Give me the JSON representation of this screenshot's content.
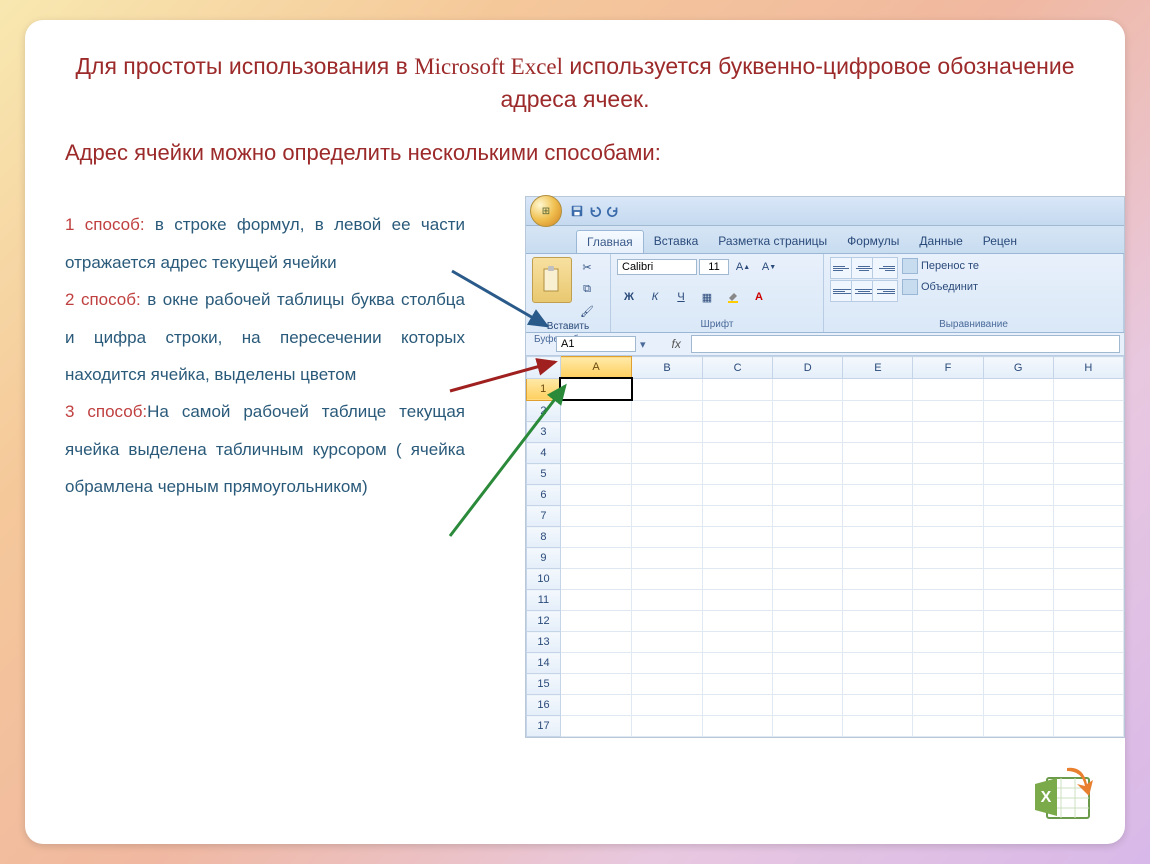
{
  "title_part1": "Для простоты использования в ",
  "title_app": "Microsoft Excel",
  "title_part2": "  используется  буквенно-цифровое обозначение адреса  ячеек.",
  "subtitle": "Адрес ячейки можно определить несколькими способами:",
  "methods": {
    "m1_label": "1 способ:",
    "m1_text": " в строке формул, в левой ее части отражается адрес текущей ячейки",
    "m2_label": "2 способ:",
    "m2_text": "  в окне рабочей таблицы буква столбца и цифра строки, на пересечении которых находится ячейка,  выделены цветом",
    "m3_label": "3 способ:",
    "m3_text": "На самой рабочей таблице текущая ячейка выделена табличным курсором ( ячейка обрамлена черным прямоугольником)"
  },
  "excel": {
    "tabs": [
      "Главная",
      "Вставка",
      "Разметка страницы",
      "Формулы",
      "Данные",
      "Рецен"
    ],
    "active_tab": 0,
    "paste_label": "Вставить",
    "group_clipboard": "Буфер обмена",
    "group_font": "Шрифт",
    "group_align": "Выравнивание",
    "font_name": "Calibri",
    "font_size": "11",
    "wrap_text": "Перенос те",
    "merge_text": "Объединит",
    "bold": "Ж",
    "italic": "К",
    "underline": "Ч",
    "namebox": "A1",
    "fx_label": "fx",
    "columns": [
      "A",
      "B",
      "C",
      "D",
      "E",
      "F",
      "G",
      "H"
    ],
    "rows": [
      "1",
      "2",
      "3",
      "4",
      "5",
      "6",
      "7",
      "8",
      "9",
      "10",
      "11",
      "12",
      "13",
      "14",
      "15",
      "16",
      "17"
    ],
    "selected_col": 0,
    "selected_row": 0
  }
}
